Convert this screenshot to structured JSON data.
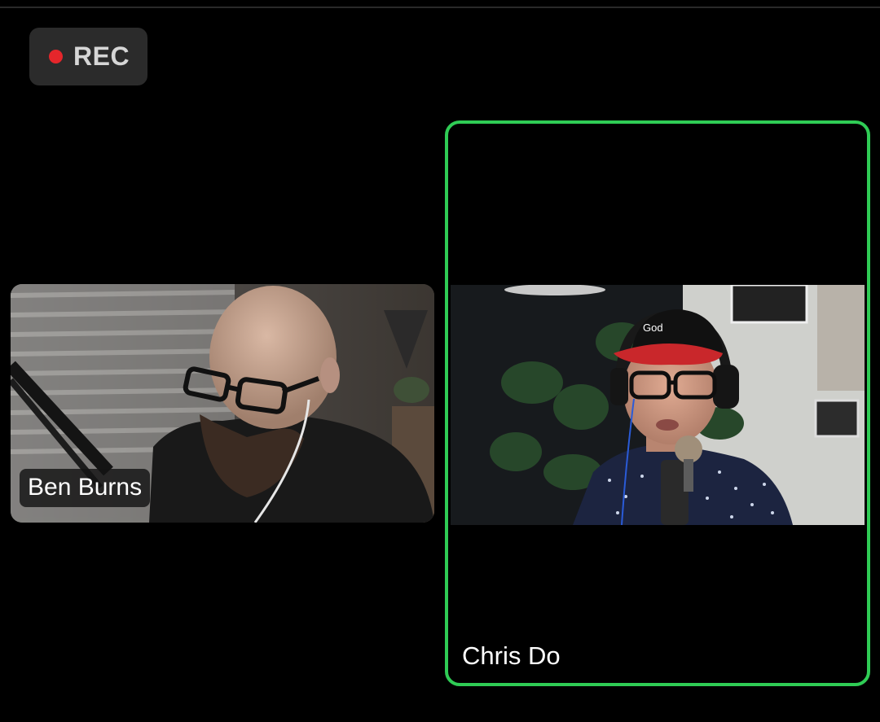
{
  "recording": {
    "label": "REC",
    "dot_color": "#e5262b"
  },
  "participants": [
    {
      "name": "Ben Burns",
      "active_speaker": false
    },
    {
      "name": "Chris Do",
      "active_speaker": true
    }
  ],
  "colors": {
    "background": "#000000",
    "active_speaker_border": "#2fcc55",
    "badge_background": "#2b2b2b"
  },
  "video_feeds": {
    "ben_burns": "man with glasses, beard and earphone at microphone",
    "chris_do": "man in red cap, headphones and glasses speaking into microphone"
  }
}
